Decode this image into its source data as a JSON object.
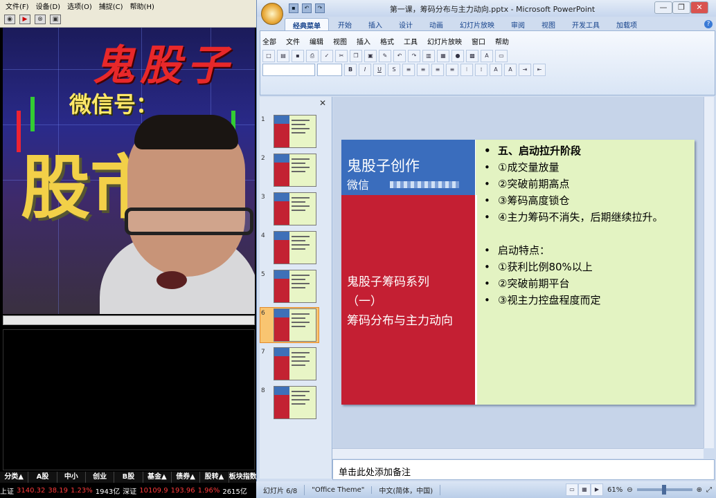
{
  "cam_app": {
    "menu": [
      "文件(F)",
      "设备(D)",
      "选项(O)",
      "捕捉(C)",
      "帮助(H)"
    ],
    "banner_title": "鬼股子",
    "banner_wechat": "微信号：",
    "banner_big": "股市"
  },
  "tickers": {
    "categories": [
      "分类▲",
      "A股",
      "中小",
      "创业",
      "B股",
      "基金▲",
      "债券▲",
      "股转▲",
      "板块指数"
    ],
    "sh_label": "上证",
    "sh_value": "3140.32",
    "sh_change": "38.19",
    "sh_pct": "1.23%",
    "sh_volume": "1943亿",
    "sz_label": "深证",
    "sz_value": "10109.9",
    "sz_change": "193.96",
    "sz_pct": "1.96%",
    "sz_volume": "2615亿"
  },
  "ppt": {
    "window_title": "第一课，筹码分布与主力动向.pptx - Microsoft PowerPoint",
    "tabs": [
      "经典菜单",
      "开始",
      "插入",
      "设计",
      "动画",
      "幻灯片放映",
      "审阅",
      "视图",
      "开发工具",
      "加载项"
    ],
    "menus": [
      "全部",
      "文件",
      "编辑",
      "视图",
      "插入",
      "格式",
      "工具",
      "幻灯片放映",
      "窗口",
      "帮助"
    ],
    "thumb_numbers": [
      "1",
      "2",
      "3",
      "4",
      "5",
      "6",
      "7",
      "8"
    ],
    "selected_slide": 6,
    "slide": {
      "author": "鬼股子创作",
      "wechat_label": "微信",
      "series_line1": "鬼股子筹码系列",
      "series_line2": "（一）",
      "series_line3": "筹码分布与主力动向",
      "bullets": [
        {
          "dot": "•",
          "text": "五、启动拉升阶段",
          "bold": true
        },
        {
          "dot": "•",
          "text": "①成交量放量"
        },
        {
          "dot": "•",
          "text": "②突破前期高点"
        },
        {
          "dot": "•",
          "text": "③筹码高度锁仓"
        },
        {
          "dot": "•",
          "text": "④主力筹码不消失，后期继续拉升。"
        },
        {
          "dot": "",
          "text": ""
        },
        {
          "dot": "•",
          "text": "启动特点："
        },
        {
          "dot": "•",
          "text": "①获利比例80%以上"
        },
        {
          "dot": "•",
          "text": "②突破前期平台"
        },
        {
          "dot": "•",
          "text": "③视主力控盘程度而定"
        }
      ]
    },
    "notes_placeholder": "单击此处添加备注",
    "status": {
      "slide_info": "幻灯片 6/8",
      "theme": "\"Office Theme\"",
      "language": "中文(简体，中国)",
      "zoom": "61%"
    }
  }
}
